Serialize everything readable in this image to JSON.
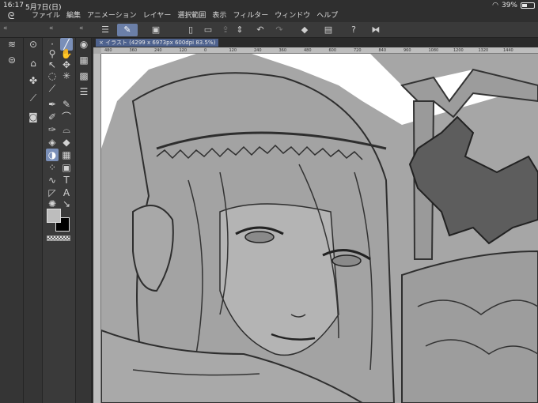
{
  "status": {
    "time": "16:17",
    "date": "5月7日(日)",
    "battery_percent": "39%",
    "battery_level": 0.39
  },
  "menu": [
    "ファイル",
    "編集",
    "アニメーション",
    "レイヤー",
    "選択範囲",
    "表示",
    "フィルター",
    "ウィンドウ",
    "ヘルプ"
  ],
  "toolbar": {
    "collapse_left": "«",
    "collapse_right": "«"
  },
  "canvas": {
    "tab_label": "× イラスト (4299 x 6973px 600dpi 83.5%)"
  },
  "ruler": {
    "ticks": [
      "480",
      "360",
      "240",
      "120",
      "0",
      "120",
      "240",
      "360",
      "480",
      "600",
      "720",
      "840",
      "960",
      "1080",
      "1200",
      "1320",
      "1440"
    ]
  },
  "colors": {
    "accent": "#6b7fa8",
    "main_color": "#bdbdbd",
    "sub_color": "#000000"
  }
}
